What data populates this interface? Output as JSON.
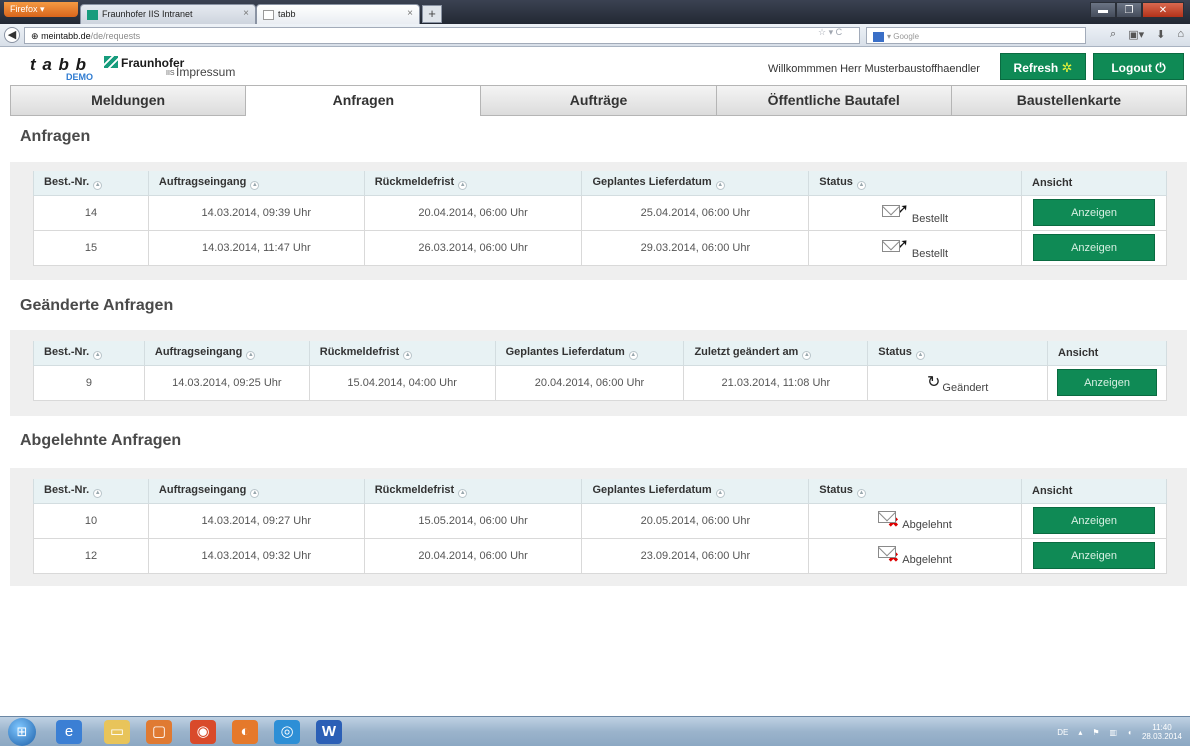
{
  "browser": {
    "firefox_label": "Firefox",
    "tabs": [
      {
        "title": "Fraunhofer IIS Intranet"
      },
      {
        "title": "tabb"
      }
    ],
    "new_tab_label": "+",
    "url_host": "meintabb.de",
    "url_path": "/de/requests",
    "search_placeholder": "Google"
  },
  "header": {
    "logo_text": "t a b b",
    "logo_demo": "DEMO",
    "fraunhofer": "Fraunhofer",
    "fraunhofer_sub": "IIS",
    "impressum": "Impressum",
    "welcome": "Willkommmen Herr Musterbaustoffhaendler",
    "refresh_label": "Refresh",
    "logout_label": "Logout"
  },
  "main_tabs": [
    {
      "label": "Meldungen"
    },
    {
      "label": "Anfragen"
    },
    {
      "label": "Aufträge"
    },
    {
      "label": "Öffentliche Bautafel"
    },
    {
      "label": "Baustellenkarte"
    }
  ],
  "requests": {
    "title": "Anfragen",
    "columns": [
      "Best.-Nr.",
      "Auftragseingang",
      "Rückmeldefrist",
      "Geplantes Lieferdatum",
      "Status",
      "Ansicht"
    ],
    "rows": [
      {
        "nr": "14",
        "eingang": "14.03.2014, 09:39 Uhr",
        "frist": "20.04.2014, 06:00 Uhr",
        "liefer": "25.04.2014, 06:00 Uhr",
        "status": "Bestellt",
        "action": "Anzeigen"
      },
      {
        "nr": "15",
        "eingang": "14.03.2014, 11:47 Uhr",
        "frist": "26.03.2014, 06:00 Uhr",
        "liefer": "29.03.2014, 06:00 Uhr",
        "status": "Bestellt",
        "action": "Anzeigen"
      }
    ]
  },
  "changed": {
    "title": "Geänderte Anfragen",
    "columns": [
      "Best.-Nr.",
      "Auftragseingang",
      "Rückmeldefrist",
      "Geplantes Lieferdatum",
      "Zuletzt geändert am",
      "Status",
      "Ansicht"
    ],
    "rows": [
      {
        "nr": "9",
        "eingang": "14.03.2014, 09:25 Uhr",
        "frist": "15.04.2014, 04:00 Uhr",
        "liefer": "20.04.2014, 06:00 Uhr",
        "geaendert": "21.03.2014, 11:08 Uhr",
        "status": "Geändert",
        "action": "Anzeigen"
      }
    ]
  },
  "rejected": {
    "title": "Abgelehnte Anfragen",
    "columns": [
      "Best.-Nr.",
      "Auftragseingang",
      "Rückmeldefrist",
      "Geplantes Lieferdatum",
      "Status",
      "Ansicht"
    ],
    "rows": [
      {
        "nr": "10",
        "eingang": "14.03.2014, 09:27 Uhr",
        "frist": "15.05.2014, 06:00 Uhr",
        "liefer": "20.05.2014, 06:00 Uhr",
        "status": "Abgelehnt",
        "action": "Anzeigen"
      },
      {
        "nr": "12",
        "eingang": "14.03.2014, 09:32 Uhr",
        "frist": "20.04.2014, 06:00 Uhr",
        "liefer": "23.09.2014, 06:00 Uhr",
        "status": "Abgelehnt",
        "action": "Anzeigen"
      }
    ]
  },
  "taskbar": {
    "language": "DE",
    "time": "11:40",
    "date": "28.03.2014"
  },
  "colors": {
    "accent_green": "#0f8a55",
    "header_row": "#e8f2f4",
    "panel_bg": "#efefef"
  }
}
